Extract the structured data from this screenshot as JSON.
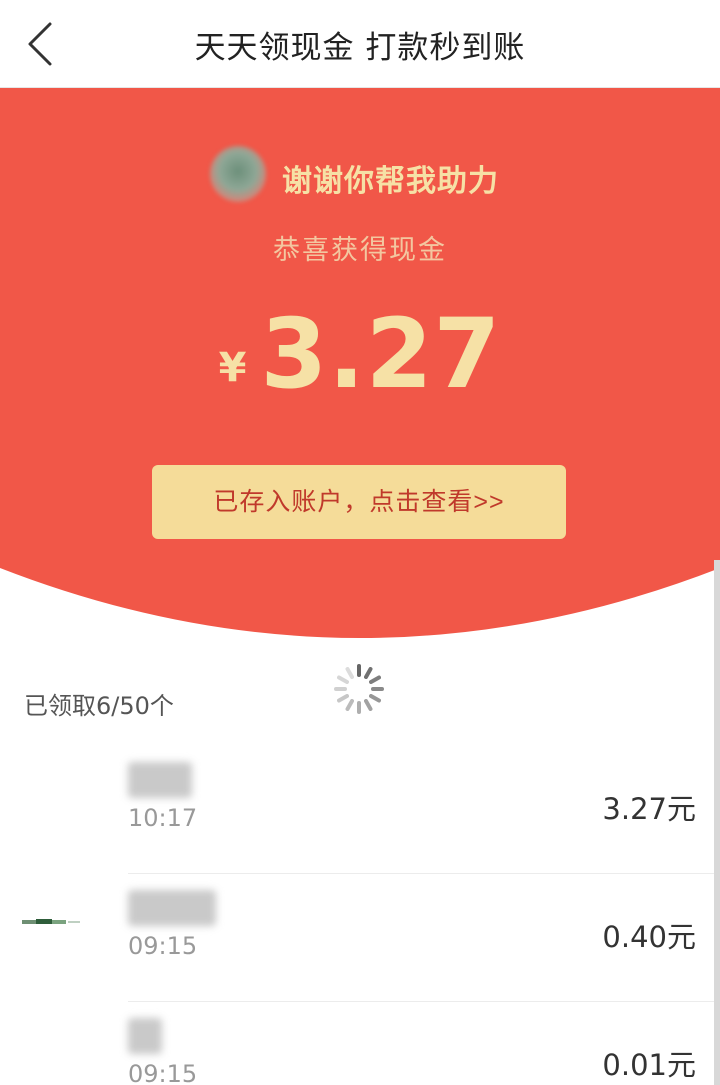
{
  "nav": {
    "back_icon": "chevron-left-icon",
    "title": "天天领现金 打款秒到账"
  },
  "hero": {
    "bg_color": "#f15748",
    "helper_text": "谢谢你帮我助力",
    "subtitle": "恭喜获得现金",
    "currency": "¥",
    "amount": "3.27",
    "button_label": "已存入账户，点击查看>>"
  },
  "list": {
    "claimed_text": "已领取6/50个",
    "records": [
      {
        "time": "10:17",
        "amount": "3.27元"
      },
      {
        "time": "09:15",
        "amount": "0.40元"
      },
      {
        "time": "09:15",
        "amount": "0.01元"
      }
    ]
  }
}
